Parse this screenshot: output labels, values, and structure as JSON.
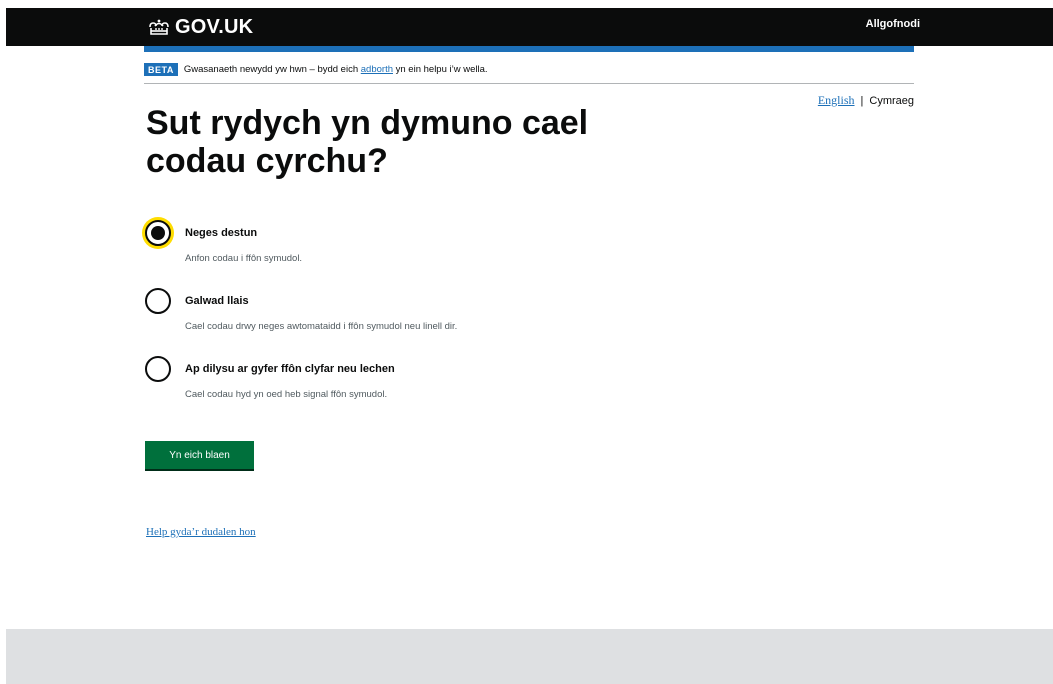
{
  "header": {
    "logo_text": "GOV.UK",
    "signout_label": "Allgofnodi"
  },
  "phase_banner": {
    "tag": "BETA",
    "text_before": "Gwasanaeth newydd yw hwn – bydd eich ",
    "link_text": "adborth",
    "text_after": " yn ein helpu i’w wella."
  },
  "language": {
    "english": "English",
    "separator": "|",
    "welsh": "Cymraeg"
  },
  "main": {
    "heading": "Sut rydych yn dymuno cael codau cyrchu?",
    "options": [
      {
        "label": "Neges destun",
        "hint": "Anfon codau i ffôn symudol.",
        "checked": true
      },
      {
        "label": "Galwad llais",
        "hint": "Cael codau drwy neges awtomataidd i ffôn symudol neu linell dir.",
        "checked": false
      },
      {
        "label": "Ap dilysu ar gyfer ffôn clyfar neu lechen",
        "hint": "Cael codau hyd yn oed heb signal ffôn symudol.",
        "checked": false
      }
    ],
    "continue_label": "Yn eich blaen",
    "help_link": "Help gyda’r dudalen hon"
  },
  "colors": {
    "header_bg": "#0b0c0c",
    "brand_blue": "#1d70b8",
    "button_green": "#00703c",
    "focus_yellow": "#ffdd00",
    "footer_bg": "#dee0e2"
  }
}
